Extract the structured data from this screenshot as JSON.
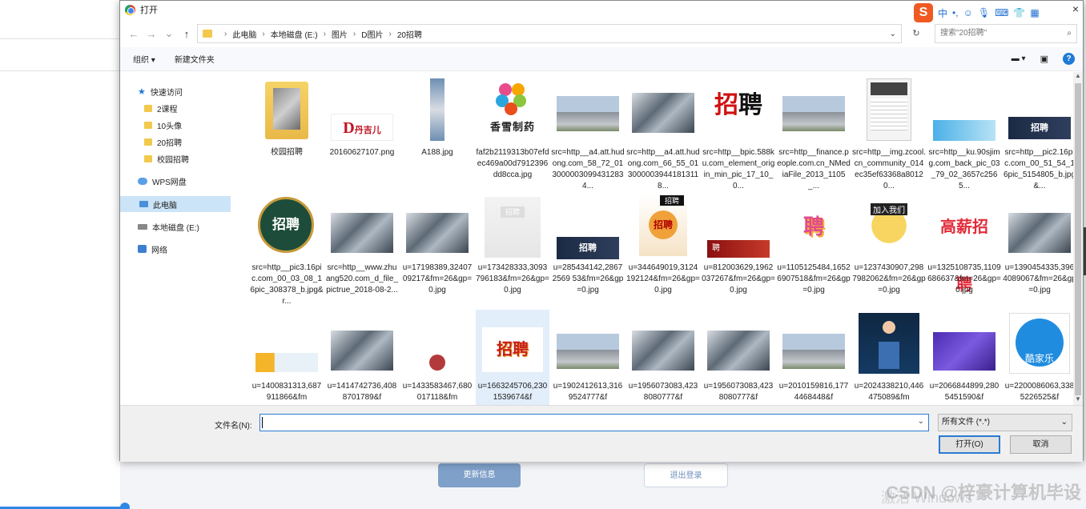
{
  "background": {
    "update_button": "更新信息",
    "logout_button": "退出登录",
    "watermark": "CSDN @梓豪计算机毕设",
    "watermark_activate": "激活 Windows"
  },
  "dialog": {
    "title": "打开",
    "close": "×",
    "ime": {
      "logo": "S",
      "items": [
        "中",
        "•,",
        "☺",
        "🎙",
        "⌨",
        "👕",
        "▦"
      ]
    },
    "breadcrumbs": [
      "此电脑",
      "本地磁盘 (E:)",
      "图片",
      "D图片",
      "20招聘"
    ],
    "search_placeholder": "搜索\"20招聘\"",
    "toolbar": {
      "organize": "组织 ▾",
      "new_folder": "新建文件夹"
    },
    "nav": [
      {
        "label": "快速访问",
        "icon": "star"
      },
      {
        "label": "2课程",
        "icon": "fold"
      },
      {
        "label": "10头像",
        "icon": "fold"
      },
      {
        "label": "20招聘",
        "icon": "fold"
      },
      {
        "label": "校园招聘",
        "icon": "fold"
      },
      {
        "label": "WPS网盘",
        "icon": "cloud"
      },
      {
        "label": "此电脑",
        "icon": "pc",
        "selected": true
      },
      {
        "label": "本地磁盘 (E:)",
        "icon": "disk"
      },
      {
        "label": "网络",
        "icon": "net"
      }
    ],
    "files": [
      {
        "name": "校园招聘",
        "kind": "folder"
      },
      {
        "name": "20160627107.png",
        "kind": "logo-red"
      },
      {
        "name": "A188.jpg",
        "kind": "tall"
      },
      {
        "name": "faf2b2119313b07efdec469a00d7912396dd8cca.jpg",
        "kind": "flower"
      },
      {
        "name": "src=http__a4.att.hudong.com_58_72_0130000030994312834...",
        "kind": "building"
      },
      {
        "name": "src=http__a4.att.hudong.com_66_55_0130000039441813118...",
        "kind": "office"
      },
      {
        "name": "src=http__bpic.588ku.com_element_origin_min_pic_17_10_0...",
        "kind": "zhaopin-black"
      },
      {
        "name": "src=http__finance.people.com.cn_NMediaFile_2013_1105_...",
        "kind": "building"
      },
      {
        "name": "src=http__img.zcool.cn_community_014ec35ef63368a80120...",
        "kind": "resume"
      },
      {
        "name": "src=http__ku.90sjimg.com_back_pic_03_79_02_3657c2565...",
        "kind": "banner-blue"
      },
      {
        "name": "src=http__pic2.16pic.com_00_51_54_16pic_5154805_b.jpg&...",
        "kind": "banner-dark"
      },
      {
        "name": "src=http__pic3.16pic.com_00_03_08_16pic_308378_b.jpg&r...",
        "kind": "circle-green"
      },
      {
        "name": "src=http__www.zhuang520.com_d_file_pictrue_2018-08-2...",
        "kind": "office"
      },
      {
        "name": "u=17198389,3240709217&fm=26&gp=0.jpg",
        "kind": "office"
      },
      {
        "name": "u=173428333,3093796183&fm=26&gp=0.jpg",
        "kind": "light"
      },
      {
        "name": "u=285434142,28672569 53&fm=26&gp=0.jpg",
        "kind": "banner-dark"
      },
      {
        "name": "u=344649019,3124192124&fm=26&gp=0.jpg",
        "kind": "zhaopin-poster"
      },
      {
        "name": "u=812003629,1962037267&fm=26&gp=0.jpg",
        "kind": "banner-red"
      },
      {
        "name": "u=1105125484,16526907518&fm=26&gp=0.jpg",
        "kind": "colorful"
      },
      {
        "name": "u=1237430907,2987982062&fm=26&gp=0.jpg",
        "kind": "cartoon"
      },
      {
        "name": "u=1325108735,1109686637&fm=26&gp=0.jpg",
        "kind": "red-white"
      },
      {
        "name": "u=1390454335,3964089067&fm=26&gp=0.jpg",
        "kind": "office"
      },
      {
        "name": "u=1400831313,687911866&fm",
        "kind": "banner-light"
      },
      {
        "name": "u=1414742736,4088701789&f",
        "kind": "office"
      },
      {
        "name": "u=1433583467,680017118&fm",
        "kind": "small-people"
      },
      {
        "name": "u=1663245706,2301539674&f",
        "kind": "zhaopin-gold",
        "selected": true
      },
      {
        "name": "u=1902412613,3169524777&f",
        "kind": "building"
      },
      {
        "name": "u=1956073083,4238080777&f",
        "kind": "office"
      },
      {
        "name": "u=1956073083,4238080777&f",
        "kind": "office"
      },
      {
        "name": "u=2010159816,1774468448&f",
        "kind": "building"
      },
      {
        "name": "u=2024338210,446475089&fm",
        "kind": "person"
      },
      {
        "name": "u=2066844899,2805451590&f",
        "kind": "purple"
      },
      {
        "name": "u=2200086063,3385226525&f",
        "kind": "blue-logo"
      }
    ],
    "filename_label": "文件名(N):",
    "filename_value": "",
    "filter_value": "所有文件 (*.*)",
    "open_button": "打开(O)",
    "cancel_button": "取消"
  }
}
